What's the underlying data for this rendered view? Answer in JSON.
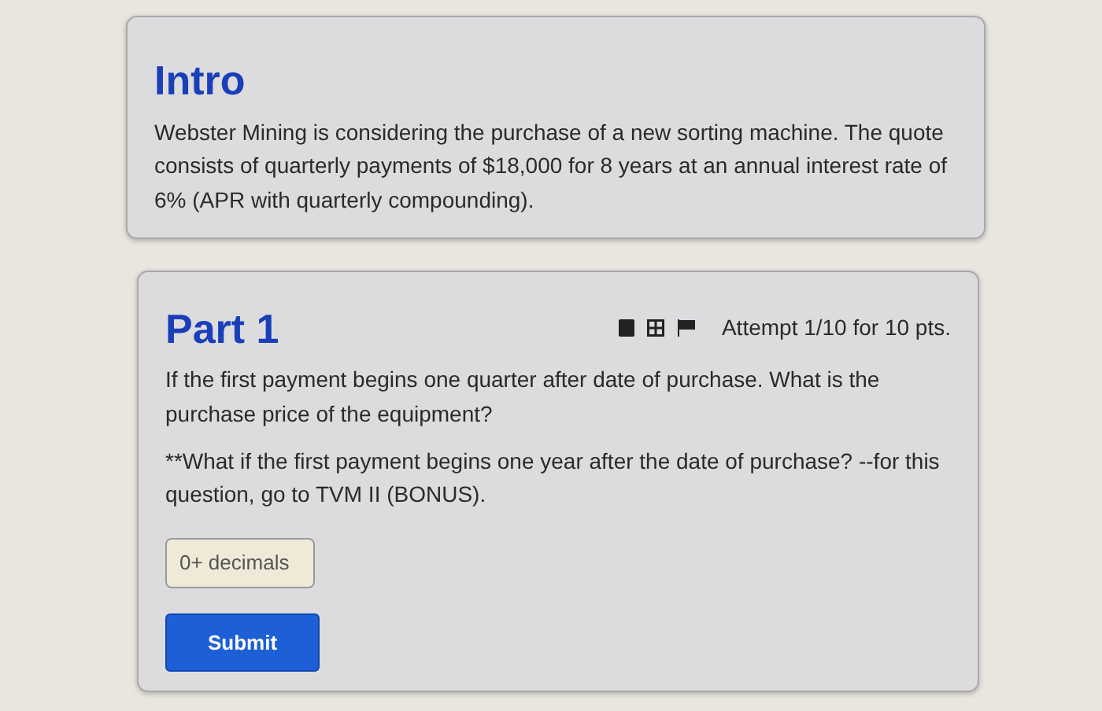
{
  "intro": {
    "title": "Intro",
    "text": "Webster Mining is considering the purchase of a new sorting machine. The quote consists of quarterly payments of $18,000 for 8 years at an annual interest rate of 6% (APR with quarterly compounding)."
  },
  "part": {
    "title": "Part 1",
    "attempt": "Attempt 1/10 for 10 pts.",
    "paragraphs": [
      "If the first payment begins one quarter after date of purchase. What is the purchase price of the equipment?",
      "**What if the first payment begins one year after the date of purchase? --for this question, go to TVM II (BONUS)."
    ],
    "answer": {
      "placeholder": "0+ decimals"
    },
    "submit": "Submit"
  }
}
